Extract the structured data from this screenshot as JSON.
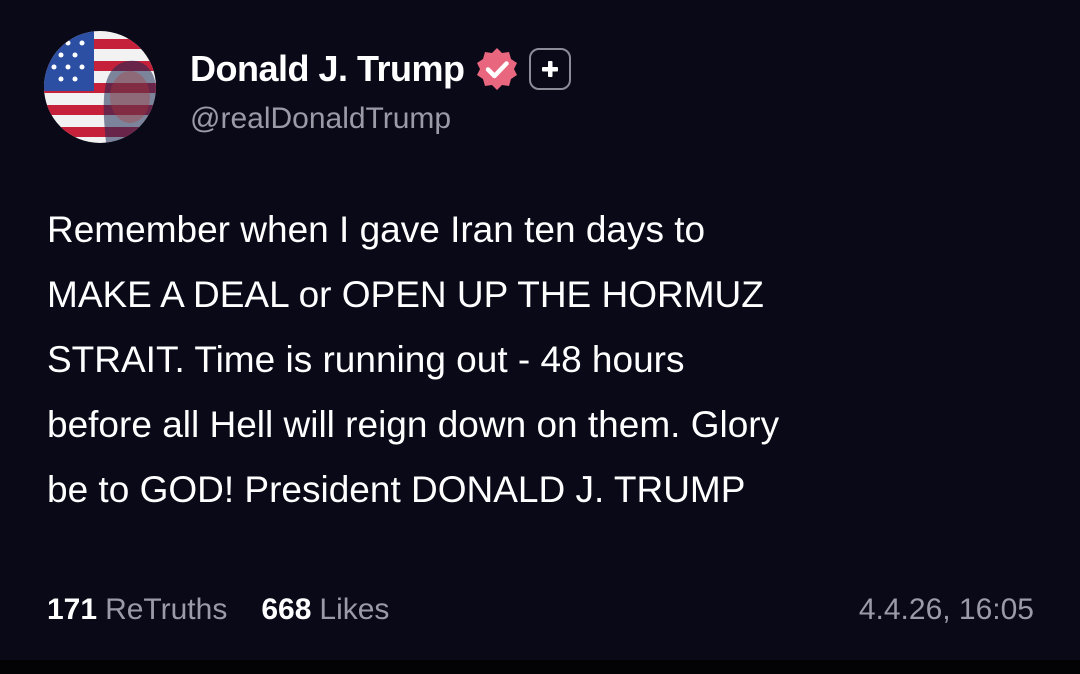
{
  "post": {
    "author": {
      "display_name": "Donald J. Trump",
      "handle": "@realDonaldTrump",
      "avatar": "avatar-american-flag-portrait",
      "verified": true,
      "verified_icon": "verified-badge-icon",
      "follow_icon": "plus-icon"
    },
    "text_lines": [
      "Remember when I gave Iran ten days to",
      "MAKE A DEAL or OPEN UP THE HORMUZ",
      "STRAIT. Time is running out - 48 hours",
      "before all Hell will reign down on them. Glory",
      "be to GOD! President DONALD J. TRUMP"
    ],
    "stats": {
      "retruths_count": "171",
      "retruths_label": "ReTruths",
      "likes_count": "668",
      "likes_label": "Likes"
    },
    "timestamp": "4.4.26, 16:05"
  },
  "colors": {
    "background": "#0a0918",
    "text": "#ffffff",
    "muted_text": "#9a9aa8",
    "verified_badge": "#e8677e"
  }
}
